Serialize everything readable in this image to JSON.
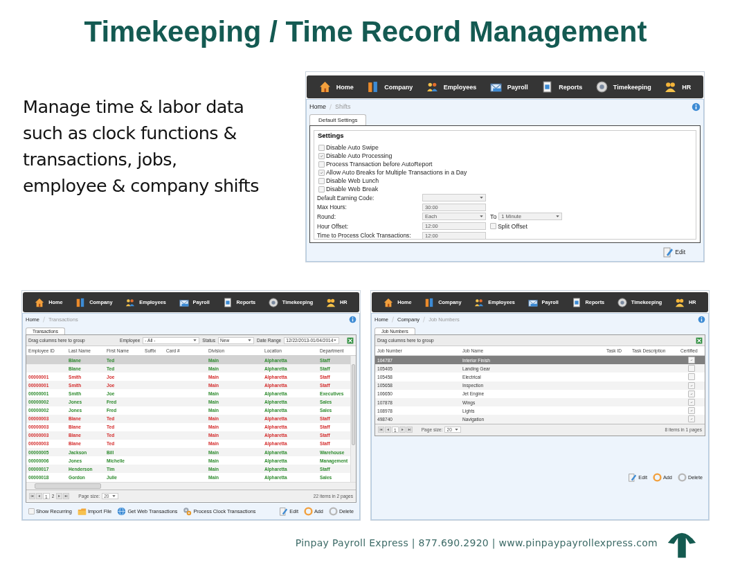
{
  "slide": {
    "title": "Timekeeping / Time Record Management",
    "description": "Manage time & labor data\nsuch as clock functions &\ntransactions, jobs,\nemployee & company shifts",
    "footer": "Pinpay Payroll Express | 877.690.2920 | www.pinpaypayrollexpress.com"
  },
  "shifts_screen": {
    "nav": [
      {
        "kind": "home",
        "label": "Home"
      },
      {
        "kind": "company",
        "label": "Company"
      },
      {
        "kind": "employees",
        "label": "Employees"
      },
      {
        "kind": "payroll",
        "label": "Payroll"
      },
      {
        "kind": "reports",
        "label": "Reports"
      },
      {
        "kind": "timekeeping",
        "label": "Timekeeping"
      },
      {
        "kind": "hr",
        "label": "HR"
      }
    ],
    "breadcrumb": [
      {
        "label": "Home",
        "current": false
      },
      {
        "label": "Shifts",
        "current": true
      }
    ],
    "tabs": [
      {
        "label": "Default Settings",
        "selected": true
      }
    ],
    "section_title": "Settings",
    "options": [
      {
        "label": "Disable Auto Swipe",
        "checked": false
      },
      {
        "label": "Disable Auto Processing",
        "checked": true
      },
      {
        "label": "Process Transaction before AutoReport",
        "checked": false
      },
      {
        "label": "Allow Auto Breaks for Multiple Transactions in a Day",
        "checked": true
      },
      {
        "label": "Disable Web Lunch",
        "checked": false
      },
      {
        "label": "Disable Web Break",
        "checked": false
      }
    ],
    "fields": [
      {
        "label": "Default Earning Code:",
        "kind": "select",
        "disabled": true
      },
      {
        "label": "Max Hours:",
        "kind": "text",
        "value": "30:00",
        "disabled": true
      },
      {
        "label": "Round:",
        "kind": "select",
        "value": "Each",
        "disabled": true,
        "to_label": "To",
        "to_value": "1 Minute"
      },
      {
        "label": "Hour Offset:",
        "kind": "text",
        "value": "12:00",
        "disabled": true,
        "checkbox": {
          "label": "Split Offset",
          "checked": false
        }
      },
      {
        "label": "Time to Process Clock Transactions:",
        "kind": "text",
        "value": "12:00",
        "disabled": true
      }
    ],
    "actions": [
      {
        "kind": "edit",
        "label": "Edit"
      }
    ]
  },
  "transactions_screen": {
    "nav": [
      {
        "kind": "home",
        "label": "Home"
      },
      {
        "kind": "company",
        "label": "Company"
      },
      {
        "kind": "employees",
        "label": "Employees"
      },
      {
        "kind": "payroll",
        "label": "Payroll"
      },
      {
        "kind": "reports",
        "label": "Reports"
      },
      {
        "kind": "timekeeping",
        "label": "Timekeeping"
      },
      {
        "kind": "hr",
        "label": "HR"
      }
    ],
    "breadcrumb": [
      {
        "label": "Home",
        "current": false
      },
      {
        "label": "Transactions",
        "current": true
      }
    ],
    "tabs": [
      {
        "label": "Transactions",
        "selected": true
      }
    ],
    "group_hint": "Drag columns here to group",
    "filters": [
      {
        "label": "Employee",
        "value": "- All -"
      },
      {
        "label": "Status",
        "value": "New"
      },
      {
        "label": "Date Range",
        "value": "12/22/2013-01/04/2014"
      }
    ],
    "columns": [
      "Employee ID",
      "Last Name",
      "First Name",
      "Suffix",
      "Card #",
      "Division",
      "Location",
      "Department"
    ],
    "rows": [
      {
        "selected": true,
        "color": "#2e8b2e",
        "cells": [
          null,
          "Blane",
          "Ted",
          null,
          null,
          "Main",
          "Alpharetta",
          "Staff"
        ]
      },
      {
        "selected": false,
        "color": "#2e8b2e",
        "cells": [
          null,
          "Blane",
          "Ted",
          null,
          null,
          "Main",
          "Alpharetta",
          "Staff"
        ]
      },
      {
        "selected": false,
        "color": "#d42c2c",
        "cells": [
          "00000001",
          "Smith",
          "Joe",
          null,
          null,
          "Main",
          "Alpharetta",
          "Staff"
        ]
      },
      {
        "selected": false,
        "color": "#d42c2c",
        "cells": [
          "00000001",
          "Smith",
          "Joe",
          null,
          null,
          "Main",
          "Alpharetta",
          "Staff"
        ]
      },
      {
        "selected": false,
        "color": "#2e8b2e",
        "cells": [
          "00000001",
          "Smith",
          "Joe",
          null,
          null,
          "Main",
          "Alpharetta",
          "Executives"
        ]
      },
      {
        "selected": false,
        "color": "#2e8b2e",
        "cells": [
          "00000002",
          "Jones",
          "Fred",
          null,
          null,
          "Main",
          "Alpharetta",
          "Sales"
        ]
      },
      {
        "selected": false,
        "color": "#2e8b2e",
        "cells": [
          "00000002",
          "Jones",
          "Fred",
          null,
          null,
          "Main",
          "Alpharetta",
          "Sales"
        ]
      },
      {
        "selected": false,
        "color": "#d42c2c",
        "cells": [
          "00000003",
          "Blane",
          "Ted",
          null,
          null,
          "Main",
          "Alpharetta",
          "Staff"
        ]
      },
      {
        "selected": false,
        "color": "#d42c2c",
        "cells": [
          "00000003",
          "Blane",
          "Ted",
          null,
          null,
          "Main",
          "Alpharetta",
          "Staff"
        ]
      },
      {
        "selected": false,
        "color": "#d42c2c",
        "cells": [
          "00000003",
          "Blane",
          "Ted",
          null,
          null,
          "Main",
          "Alpharetta",
          "Staff"
        ]
      },
      {
        "selected": false,
        "color": "#d42c2c",
        "cells": [
          "00000003",
          "Blane",
          "Ted",
          null,
          null,
          "Main",
          "Alpharetta",
          "Staff"
        ]
      },
      {
        "selected": false,
        "color": "#2e8b2e",
        "cells": [
          "00000005",
          "Jackson",
          "Bill",
          null,
          null,
          "Main",
          "Alpharetta",
          "Warehouse"
        ]
      },
      {
        "selected": false,
        "color": "#2e8b2e",
        "cells": [
          "00000006",
          "Jones",
          "Michelle",
          null,
          null,
          "Main",
          "Alpharetta",
          "Management"
        ]
      },
      {
        "selected": false,
        "color": "#2e8b2e",
        "cells": [
          "00000017",
          "Henderson",
          "Tim",
          null,
          null,
          "Main",
          "Alpharetta",
          "Staff"
        ]
      },
      {
        "selected": false,
        "color": "#2e8b2e",
        "cells": [
          "00000018",
          "Gordon",
          "Julie",
          null,
          null,
          "Main",
          "Alpharetta",
          "Sales"
        ]
      }
    ],
    "pager": {
      "pages": [
        {
          "label": "1",
          "selected": true
        },
        {
          "label": "2",
          "selected": false
        }
      ],
      "page_size_label": "Page size:",
      "page_size": "20",
      "info": "22 items in 2 pages"
    },
    "show_recurring": {
      "label": "Show Recurring",
      "checked": false
    },
    "actions": [
      {
        "kind": "import",
        "label": "Import File"
      },
      {
        "kind": "web",
        "label": "Get Web Transactions"
      },
      {
        "kind": "process",
        "label": "Process Clock Transactions"
      },
      {
        "kind": "edit",
        "label": "Edit"
      },
      {
        "kind": "add",
        "label": "Add"
      },
      {
        "kind": "delete",
        "label": "Delete"
      }
    ]
  },
  "jobs_screen": {
    "nav": [
      {
        "kind": "home",
        "label": "Home"
      },
      {
        "kind": "company",
        "label": "Company"
      },
      {
        "kind": "employees",
        "label": "Employees"
      },
      {
        "kind": "payroll",
        "label": "Payroll"
      },
      {
        "kind": "reports",
        "label": "Reports"
      },
      {
        "kind": "timekeeping",
        "label": "Timekeeping"
      },
      {
        "kind": "hr",
        "label": "HR"
      }
    ],
    "breadcrumb": [
      {
        "label": "Home",
        "current": false
      },
      {
        "label": "Company",
        "current": false
      },
      {
        "label": "Job Numbers",
        "current": true
      }
    ],
    "tabs": [
      {
        "label": "Job Numbers",
        "selected": true
      }
    ],
    "group_hint": "Drag columns here to group",
    "columns": [
      "Job Number",
      "Job Name",
      "Task ID",
      "Task Description",
      "Certified"
    ],
    "rows": [
      {
        "selected": true,
        "job_number": "104787",
        "job_name": "Interior Finish",
        "certified": true
      },
      {
        "selected": false,
        "job_number": "105405",
        "job_name": "Landing Gear",
        "certified": false
      },
      {
        "selected": false,
        "job_number": "105458",
        "job_name": "Electrical",
        "certified": false
      },
      {
        "selected": false,
        "job_number": "105658",
        "job_name": "Inspection",
        "certified": true
      },
      {
        "selected": false,
        "job_number": "106650",
        "job_name": "Jet Engine",
        "certified": true
      },
      {
        "selected": false,
        "job_number": "107878",
        "job_name": "Wings",
        "certified": true
      },
      {
        "selected": false,
        "job_number": "108978",
        "job_name": "Lights",
        "certified": true
      },
      {
        "selected": false,
        "job_number": "498740",
        "job_name": "Navigation",
        "certified": true
      }
    ],
    "pager": {
      "pages": [
        {
          "label": "1",
          "selected": true
        }
      ],
      "page_size_label": "Page size:",
      "page_size": "20",
      "info": "8 items in 1 pages"
    },
    "actions": [
      {
        "kind": "edit",
        "label": "Edit"
      },
      {
        "kind": "add",
        "label": "Add"
      },
      {
        "kind": "delete",
        "label": "Delete"
      }
    ]
  }
}
